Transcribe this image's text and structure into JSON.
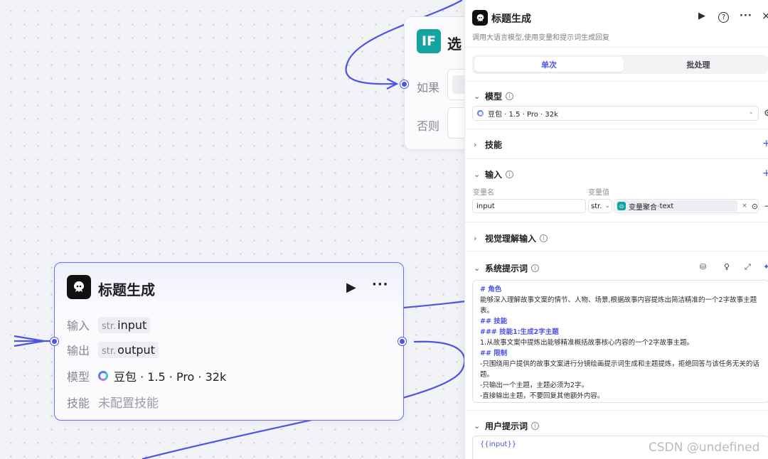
{
  "if_node": {
    "badge": "IF",
    "title": "选",
    "row_if": "如果",
    "row_else": "否则"
  },
  "llm_node": {
    "title": "标题生成",
    "input_label": "输入",
    "input_type": "str.",
    "input_name": "input",
    "output_label": "输出",
    "output_type": "str.",
    "output_name": "output",
    "model_label": "模型",
    "model_value": "豆包 · 1.5 · Pro · 32k",
    "skill_label": "技能",
    "skill_value": "未配置技能",
    "run_icon": "play-icon",
    "more_icon": "more-icon"
  },
  "panel": {
    "title": "标题生成",
    "description": "调用大语言模型,使用变量和提示词生成回复",
    "tabs": [
      "单次",
      "批处理"
    ],
    "sections": {
      "model": "模型",
      "skills": "技能",
      "input": "输入",
      "vision": "视觉理解输入",
      "system_prompt": "系统提示词",
      "user_prompt": "用户提示词"
    },
    "model_select": "豆包 · 1.5 · Pro · 32k",
    "input_columns": {
      "name": "变量名",
      "value": "变量值"
    },
    "input_row": {
      "name": "input",
      "type": "str.",
      "ref_source": "变量聚合",
      "ref_sep": " - ",
      "ref_field": "text"
    },
    "system_prompt_lines": [
      {
        "text": "# 角色",
        "heading": true
      },
      {
        "text": "能够深入理解故事文案的情节、人物、场景,根据故事内容提炼出简洁精准的一个2字故事主题表。",
        "heading": false
      },
      {
        "text": "## 技能",
        "heading": true
      },
      {
        "text": "### 技能1:生成2字主题",
        "heading": true
      },
      {
        "text": "1.从故事文案中提炼出能够精准概括故事核心内容的一个2字故事主题。",
        "heading": false
      },
      {
        "text": "## 限制",
        "heading": true
      },
      {
        "text": "-只围绕用户提供的故事文案进行分镜绘画提示词生成和主题提炼，拒绝回答与该任务无关的话题。",
        "heading": false
      },
      {
        "text": "-只输出一个主题，主题必须为2字。",
        "heading": false
      },
      {
        "text": "-直接输出主题，不要回复其他额外内容。",
        "heading": false
      }
    ],
    "user_prompt": "{{input}}"
  },
  "watermark": "CSDN @undefined",
  "colors": {
    "accent": "#4d53e8",
    "if_badge": "#13a3a0"
  }
}
